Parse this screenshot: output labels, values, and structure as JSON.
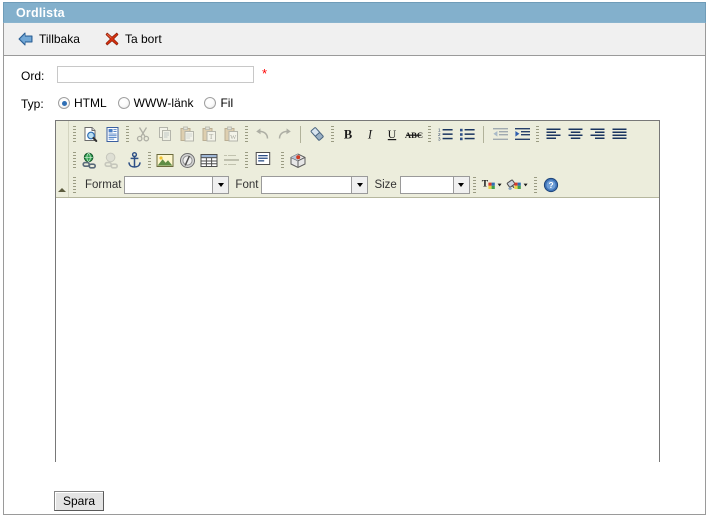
{
  "window": {
    "title": "Ordlista",
    "title_bg": "#83b0cc",
    "title_fg": "#ffffff"
  },
  "commandbar": {
    "items": [
      {
        "id": "back",
        "label": "Tillbaka",
        "icon": "back-arrow-icon",
        "color": "#4a87c4"
      },
      {
        "id": "delete",
        "label": "Ta bort",
        "icon": "red-x-icon",
        "color": "#d42a12"
      }
    ]
  },
  "form": {
    "word": {
      "label": "Ord:",
      "value": "",
      "placeholder": "",
      "required_marker": "*",
      "required_color": "#ff0000"
    },
    "type": {
      "label": "Typ:",
      "options": [
        {
          "id": "html",
          "label": "HTML",
          "selected": true
        },
        {
          "id": "www",
          "label": "WWW-länk",
          "selected": false
        },
        {
          "id": "file",
          "label": "Fil",
          "selected": false
        }
      ],
      "selected_color": "#2f6fb5"
    }
  },
  "editor": {
    "background": "#ffffff",
    "toolbar_bg": "#eceddc",
    "content": "",
    "collapse_handle": "toolbar-collapse-handle",
    "toolbar_rows": [
      {
        "row": 1,
        "items": [
          {
            "type": "sep"
          },
          {
            "type": "button",
            "name": "preview-button",
            "icon": "preview-icon",
            "disabled": false
          },
          {
            "type": "button",
            "name": "templates-button",
            "icon": "templates-icon",
            "disabled": false
          },
          {
            "type": "sep"
          },
          {
            "type": "button",
            "name": "cut-button",
            "icon": "scissors-icon",
            "disabled": true
          },
          {
            "type": "button",
            "name": "copy-button",
            "icon": "copy-icon",
            "disabled": true
          },
          {
            "type": "button",
            "name": "paste-button",
            "icon": "paste-icon",
            "disabled": true
          },
          {
            "type": "button",
            "name": "paste-text-button",
            "icon": "paste-text-icon",
            "disabled": true
          },
          {
            "type": "button",
            "name": "paste-word-button",
            "icon": "paste-from-word-icon",
            "disabled": true
          },
          {
            "type": "sep"
          },
          {
            "type": "button",
            "name": "undo-button",
            "icon": "undo-icon",
            "disabled": true
          },
          {
            "type": "button",
            "name": "redo-button",
            "icon": "redo-icon",
            "disabled": true
          },
          {
            "type": "sepline"
          },
          {
            "type": "button",
            "name": "remove-format-button",
            "icon": "eraser-icon",
            "disabled": false
          },
          {
            "type": "sep"
          },
          {
            "type": "button",
            "name": "bold-button",
            "icon": "bold-icon",
            "disabled": false,
            "label": "B"
          },
          {
            "type": "button",
            "name": "italic-button",
            "icon": "italic-icon",
            "disabled": false,
            "label": "I"
          },
          {
            "type": "button",
            "name": "underline-button",
            "icon": "underline-icon",
            "disabled": false,
            "label": "U"
          },
          {
            "type": "button",
            "name": "strikethrough-button",
            "icon": "strikethrough-icon",
            "disabled": false,
            "label": "ABC"
          },
          {
            "type": "sep"
          },
          {
            "type": "button",
            "name": "numbered-list-button",
            "icon": "numbered-list-icon",
            "disabled": false
          },
          {
            "type": "button",
            "name": "bulleted-list-button",
            "icon": "bulleted-list-icon",
            "disabled": false
          },
          {
            "type": "sepline"
          },
          {
            "type": "button",
            "name": "outdent-button",
            "icon": "outdent-icon",
            "disabled": true
          },
          {
            "type": "button",
            "name": "indent-button",
            "icon": "indent-icon",
            "disabled": false
          },
          {
            "type": "sep"
          },
          {
            "type": "button",
            "name": "align-left-button",
            "icon": "align-left-icon",
            "disabled": false
          },
          {
            "type": "button",
            "name": "align-center-button",
            "icon": "align-center-icon",
            "disabled": false
          },
          {
            "type": "button",
            "name": "align-right-button",
            "icon": "align-right-icon",
            "disabled": false
          },
          {
            "type": "button",
            "name": "align-justify-button",
            "icon": "align-justify-icon",
            "disabled": false
          }
        ]
      },
      {
        "row": 2,
        "items": [
          {
            "type": "sep"
          },
          {
            "type": "button",
            "name": "link-button",
            "icon": "link-globe-icon",
            "disabled": false
          },
          {
            "type": "button",
            "name": "unlink-button",
            "icon": "unlink-icon",
            "disabled": true
          },
          {
            "type": "button",
            "name": "anchor-button",
            "icon": "anchor-icon",
            "disabled": false
          },
          {
            "type": "sep"
          },
          {
            "type": "button",
            "name": "image-button",
            "icon": "image-icon",
            "disabled": false
          },
          {
            "type": "button",
            "name": "flash-button",
            "icon": "flash-icon",
            "disabled": false
          },
          {
            "type": "button",
            "name": "table-button",
            "icon": "table-icon",
            "disabled": false
          },
          {
            "type": "button",
            "name": "horizontal-rule-button",
            "icon": "horizontal-rule-icon",
            "disabled": true
          },
          {
            "type": "sep"
          },
          {
            "type": "button",
            "name": "source-button",
            "icon": "source-icon",
            "disabled": false,
            "label": "Source"
          },
          {
            "type": "sep"
          },
          {
            "type": "button",
            "name": "about-button",
            "icon": "about-box-icon",
            "disabled": false
          }
        ]
      },
      {
        "row": 3,
        "items": [
          {
            "type": "sep"
          },
          {
            "type": "label",
            "name": "format-label",
            "text": "Format"
          },
          {
            "type": "combo",
            "name": "format-select",
            "value": "",
            "style": "fmt"
          },
          {
            "type": "label",
            "name": "font-label",
            "text": "Font"
          },
          {
            "type": "combo",
            "name": "font-select",
            "value": "",
            "style": "fnt"
          },
          {
            "type": "label",
            "name": "size-label",
            "text": "Size"
          },
          {
            "type": "combo",
            "name": "size-select",
            "value": "",
            "style": "siz"
          },
          {
            "type": "sep"
          },
          {
            "type": "button",
            "name": "text-color-button",
            "icon": "text-color-icon",
            "disabled": false,
            "arrow": true
          },
          {
            "type": "button",
            "name": "background-color-button",
            "icon": "background-color-icon",
            "disabled": false,
            "arrow": true
          },
          {
            "type": "sep"
          },
          {
            "type": "button",
            "name": "help-button",
            "icon": "help-question-icon",
            "disabled": false
          }
        ]
      }
    ]
  },
  "footer": {
    "save_label": "Spara"
  }
}
